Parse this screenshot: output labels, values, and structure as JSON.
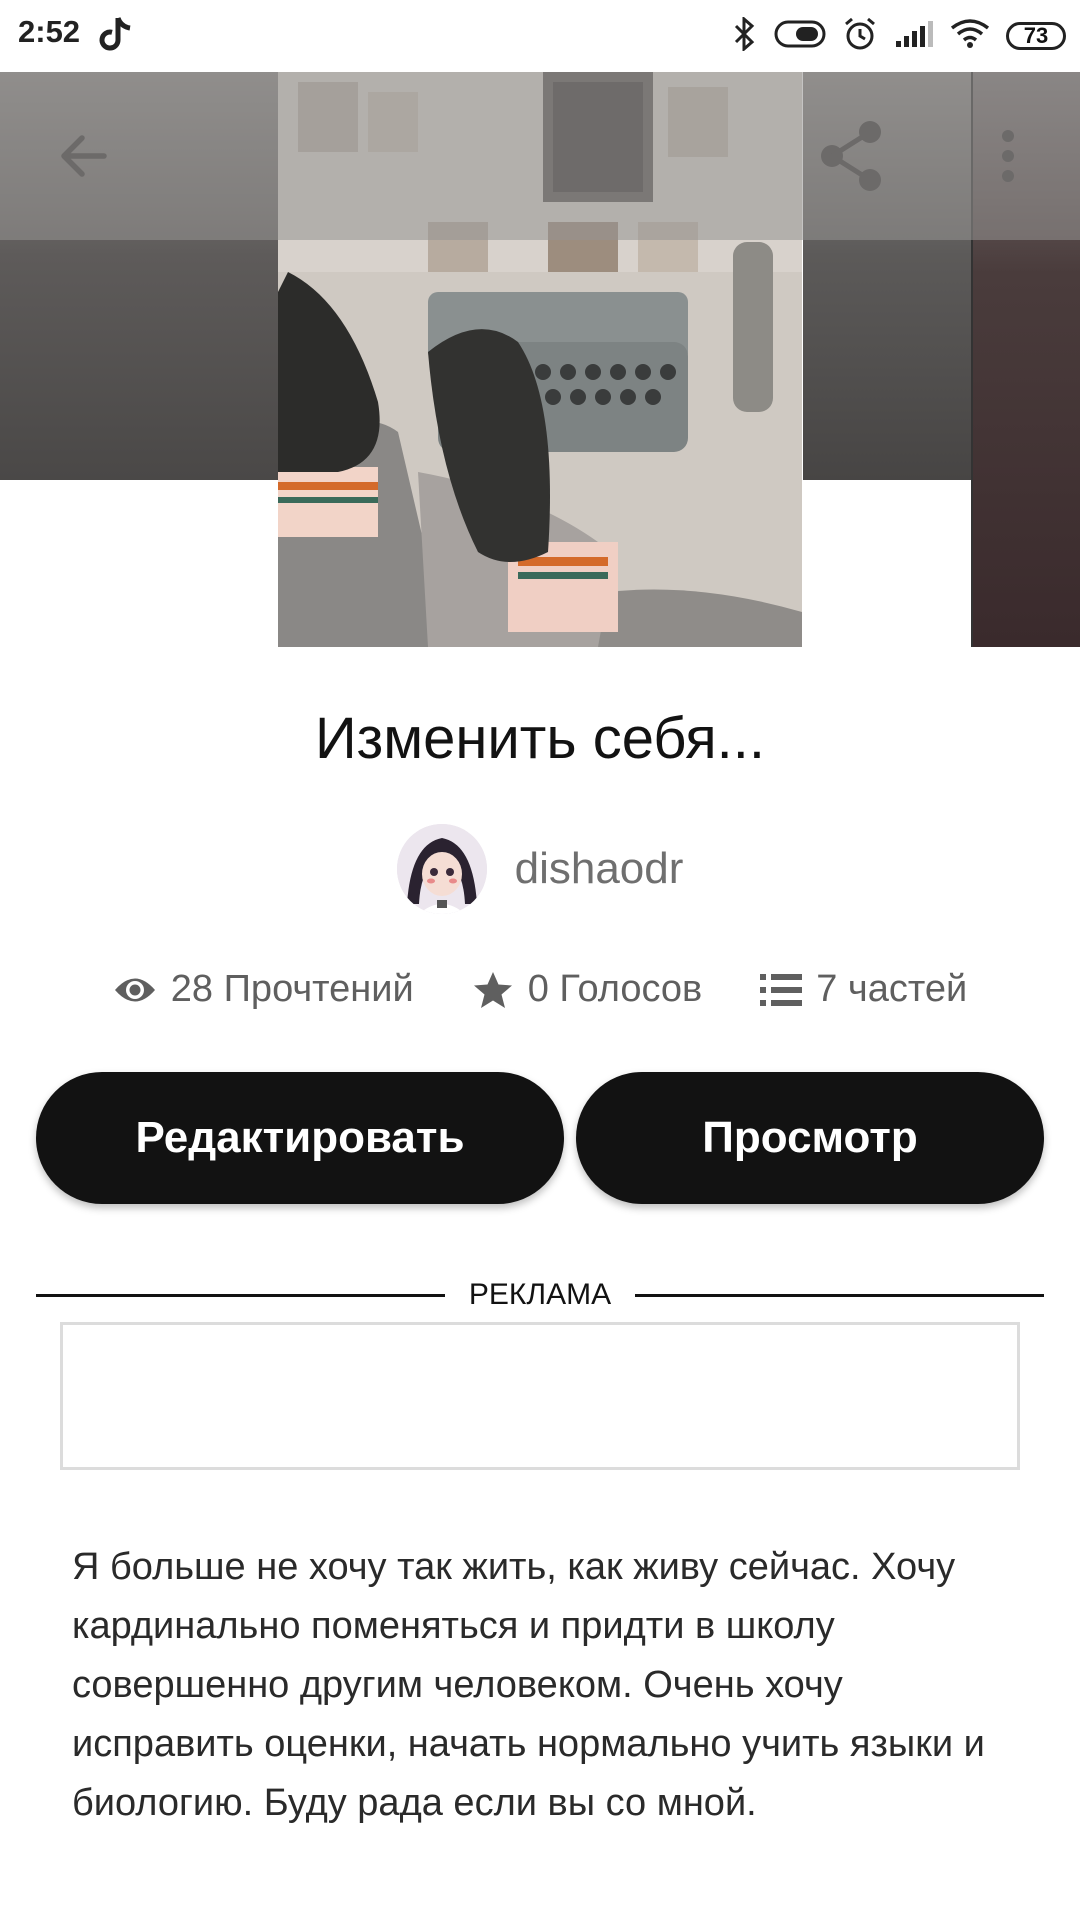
{
  "status_bar": {
    "time": "2:52",
    "battery": "73"
  },
  "toolbar": {
    "back_icon": "arrow-left-icon",
    "share_icon": "share-icon",
    "more_icon": "more-vert-icon"
  },
  "story": {
    "title": "Изменить себя...",
    "author": "dishaodr",
    "reads": "28 Прочтений",
    "votes": "0 Голосов",
    "parts": "7 частей",
    "description": "Я больше не хочу так жить, как живу сейчас. Хочу кардинально поменяться и придти в школу совершенно другим человеком. Очень хочу исправить оценки, начать нормально учить языки и биологию. Буду рада если вы со мной."
  },
  "buttons": {
    "edit": "Редактировать",
    "view": "Просмотр"
  },
  "ad": {
    "label": "РЕКЛАМА"
  }
}
